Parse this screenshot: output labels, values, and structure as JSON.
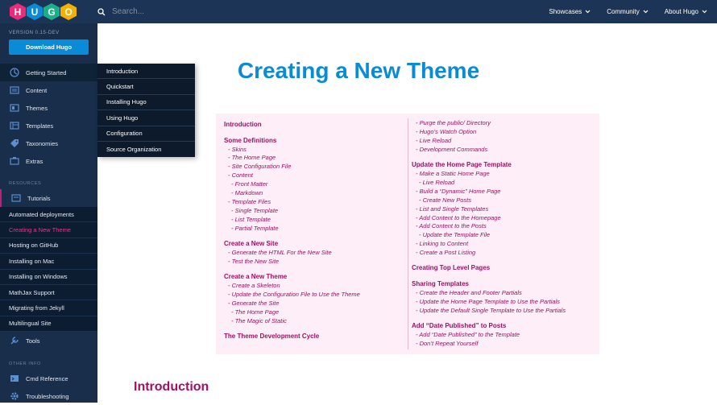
{
  "header": {
    "logo_letters": [
      "H",
      "U",
      "G",
      "O"
    ],
    "logo_colors": [
      "#ee2a7b",
      "#0a8bd8",
      "#1cb088",
      "#f5b100"
    ],
    "search_placeholder": "Search...",
    "nav": [
      "Showcases",
      "Community",
      "About Hugo"
    ]
  },
  "sidebar": {
    "version": "VERSION 0.15-DEV",
    "download_label": "Download Hugo",
    "items": [
      {
        "label": "Getting Started",
        "icon": "rocket-icon"
      },
      {
        "label": "Content",
        "icon": "content-icon"
      },
      {
        "label": "Themes",
        "icon": "themes-icon"
      },
      {
        "label": "Templates",
        "icon": "templates-icon"
      },
      {
        "label": "Taxonomies",
        "icon": "tag-icon"
      },
      {
        "label": "Extras",
        "icon": "extras-icon"
      }
    ],
    "resources_heading": "RESOURCES",
    "tutorials_label": "Tutorials",
    "tutorial_items": [
      "Automated deployments",
      "Creating a New Theme",
      "Hosting on GitHub",
      "Installing on Mac",
      "Installing on Windows",
      "MathJax Support",
      "Migrating from Jekyll",
      "Multilingual Site"
    ],
    "tools_label": "Tools",
    "other_heading": "OTHER INFO",
    "other_items": [
      "Cmd Reference",
      "Troubleshooting"
    ]
  },
  "dropdown": [
    "Introduction",
    "Quickstart",
    "Installing Hugo",
    "Using Hugo",
    "Configuration",
    "Source Organization"
  ],
  "page_title": "Creating a New Theme",
  "toc": {
    "left": [
      {
        "t": "h",
        "text": "Introduction"
      },
      {
        "t": "sp"
      },
      {
        "t": "h",
        "text": "Some Definitions"
      },
      {
        "t": "s",
        "text": "- Skins"
      },
      {
        "t": "s",
        "text": "- The Home Page"
      },
      {
        "t": "s",
        "text": "- Site Configuration File"
      },
      {
        "t": "s",
        "text": "- Content"
      },
      {
        "t": "s2",
        "text": "- Front Matter"
      },
      {
        "t": "s2",
        "text": "- Markdown"
      },
      {
        "t": "s",
        "text": "- Template Files"
      },
      {
        "t": "s2",
        "text": "- Single Template"
      },
      {
        "t": "s2",
        "text": "- List Template"
      },
      {
        "t": "s2",
        "text": "- Partial Template"
      },
      {
        "t": "sp"
      },
      {
        "t": "h",
        "text": "Create a New Site"
      },
      {
        "t": "s",
        "text": "- Generate the HTML For the New Site"
      },
      {
        "t": "s",
        "text": "- Test the New Site"
      },
      {
        "t": "sp"
      },
      {
        "t": "h",
        "text": "Create a New Theme"
      },
      {
        "t": "s",
        "text": "- Create a Skeleton"
      },
      {
        "t": "s",
        "text": "- Update the Configuration File to Use the Theme"
      },
      {
        "t": "s",
        "text": "- Generate the Site"
      },
      {
        "t": "s2",
        "text": "- The Home Page"
      },
      {
        "t": "s2",
        "text": "- The Magic of Static"
      },
      {
        "t": "sp"
      },
      {
        "t": "h",
        "text": "The Theme Development Cycle"
      }
    ],
    "right": [
      {
        "t": "s",
        "text": "- Purge the public/ Directory"
      },
      {
        "t": "s",
        "text": "- Hugo’s Watch Option"
      },
      {
        "t": "s",
        "text": "- Live Reload"
      },
      {
        "t": "s",
        "text": "- Development Commands"
      },
      {
        "t": "sp"
      },
      {
        "t": "h",
        "text": "Update the Home Page Template"
      },
      {
        "t": "s",
        "text": "- Make a Static Home Page"
      },
      {
        "t": "s2",
        "text": "- Live Reload"
      },
      {
        "t": "s",
        "text": "- Build a “Dynamic” Home Page"
      },
      {
        "t": "s2",
        "text": "- Create New Posts"
      },
      {
        "t": "s",
        "text": "- List and Single Templates"
      },
      {
        "t": "s",
        "text": "- Add Content to the Homepage"
      },
      {
        "t": "s",
        "text": "- Add Content to the Posts"
      },
      {
        "t": "s2",
        "text": "- Update the Template File"
      },
      {
        "t": "s",
        "text": "- Linking to Content"
      },
      {
        "t": "s",
        "text": "- Create a Post Listing"
      },
      {
        "t": "sp"
      },
      {
        "t": "h",
        "text": "Creating Top Level Pages"
      },
      {
        "t": "sp"
      },
      {
        "t": "h",
        "text": "Sharing Templates"
      },
      {
        "t": "s",
        "text": "- Create the Header and Footer Partials"
      },
      {
        "t": "s",
        "text": "- Update the Home Page Template to Use the Partials"
      },
      {
        "t": "s",
        "text": "- Update the Default Single Template to Use the Partials"
      },
      {
        "t": "sp"
      },
      {
        "t": "h",
        "text": "Add “Date Published” to Posts"
      },
      {
        "t": "s",
        "text": "- Add “Date Published” to the Template"
      },
      {
        "t": "s",
        "text": "- Don’t Repeat Yourself"
      }
    ]
  },
  "intro_heading": "Introduction"
}
